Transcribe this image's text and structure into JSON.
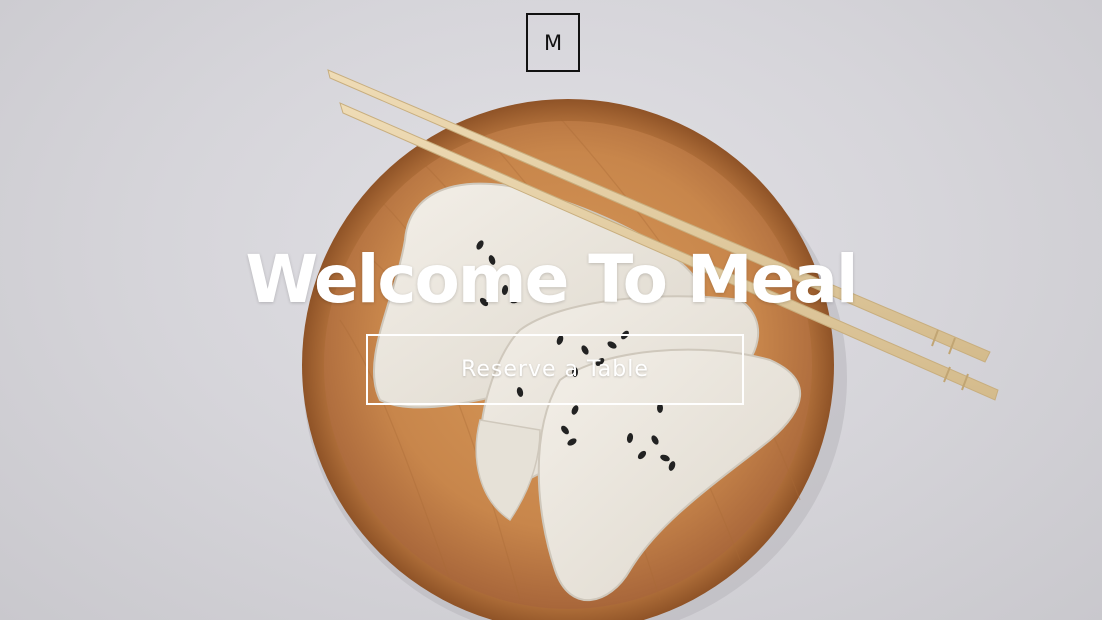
{
  "brand": {
    "logo_letter": "M"
  },
  "hero": {
    "headline": "Welcome To Meal",
    "cta_label": "Reserve a Table",
    "image_subject": "dumplings-on-wooden-plate-with-chopsticks"
  },
  "colors": {
    "background": "#d6d5da",
    "text": "#ffffff",
    "logo": "#111111",
    "plate": "#c58a4c",
    "dumpling": "#eae6dd",
    "chopsticks": "#e4cfa6",
    "sesame": "#222222"
  }
}
